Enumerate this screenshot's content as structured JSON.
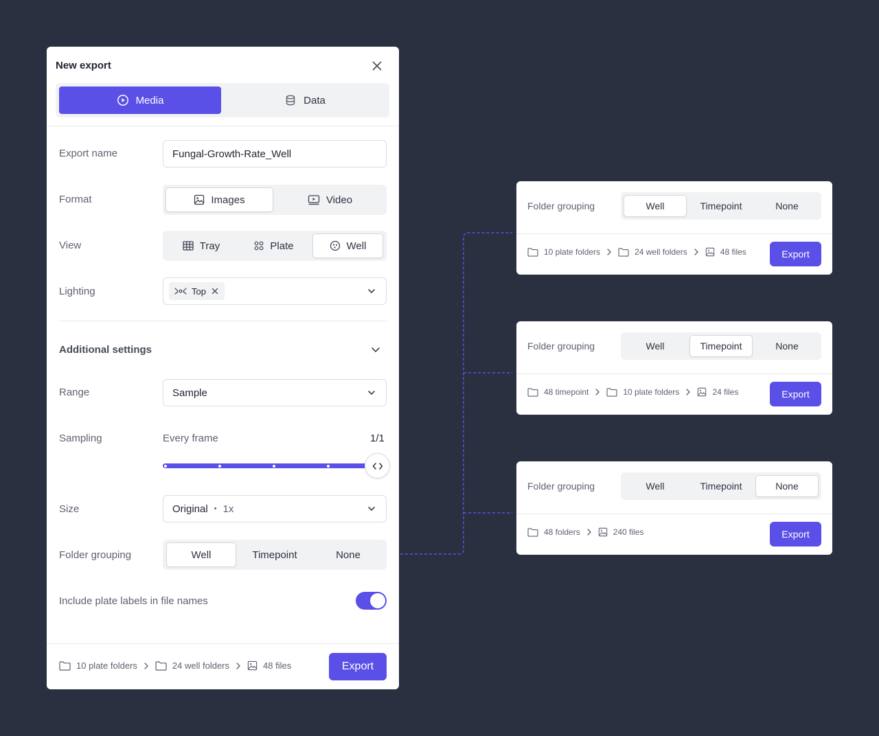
{
  "dialog": {
    "title": "New export",
    "type_tabs": [
      {
        "label": "Media",
        "icon": "play-circle-icon",
        "active": true
      },
      {
        "label": "Data",
        "icon": "database-icon",
        "active": false
      }
    ],
    "export_name": {
      "label": "Export name",
      "value": "Fungal-Growth-Rate_Well"
    },
    "format": {
      "label": "Format",
      "options": [
        {
          "label": "Images",
          "icon": "image-icon",
          "active": true
        },
        {
          "label": "Video",
          "icon": "video-icon",
          "active": false
        }
      ]
    },
    "view": {
      "label": "View",
      "options": [
        {
          "label": "Tray",
          "icon": "grid-icon",
          "active": false
        },
        {
          "label": "Plate",
          "icon": "dots-grid-icon",
          "active": false
        },
        {
          "label": "Well",
          "icon": "well-icon",
          "active": true
        }
      ]
    },
    "lighting": {
      "label": "Lighting",
      "chip": "Top"
    },
    "additional_settings": {
      "title": "Additional settings"
    },
    "range": {
      "label": "Range",
      "value": "Sample"
    },
    "sampling": {
      "label": "Sampling",
      "value": "Every frame",
      "ratio": "1/1",
      "level": 1.0
    },
    "size": {
      "label": "Size",
      "value": "Original",
      "separator": "•",
      "multiplier": "1x"
    },
    "folder_grouping": {
      "label": "Folder grouping",
      "options": [
        "Well",
        "Timepoint",
        "None"
      ],
      "selected": 0
    },
    "include_labels": {
      "label": "Include plate labels in file names",
      "on": true
    },
    "footer": {
      "path": [
        "10 plate folders",
        "24 well folders",
        "48 files"
      ],
      "export_label": "Export"
    }
  },
  "cards": [
    {
      "label": "Folder grouping",
      "options": [
        "Well",
        "Timepoint",
        "None"
      ],
      "selected": 0,
      "path": [
        "10 plate folders",
        "24 well folders",
        "48 files"
      ],
      "export_label": "Export"
    },
    {
      "label": "Folder grouping",
      "options": [
        "Well",
        "Timepoint",
        "None"
      ],
      "selected": 1,
      "path": [
        "48 timepoint",
        "10 plate folders",
        "24 files"
      ],
      "export_label": "Export"
    },
    {
      "label": "Folder grouping",
      "options": [
        "Well",
        "Timepoint",
        "None"
      ],
      "selected": 2,
      "path": [
        "48 folders",
        "240 files"
      ],
      "export_label": "Export"
    }
  ],
  "colors": {
    "accent": "#5a4fe6",
    "background": "#2b3040",
    "connector": "#5a4fe6"
  }
}
